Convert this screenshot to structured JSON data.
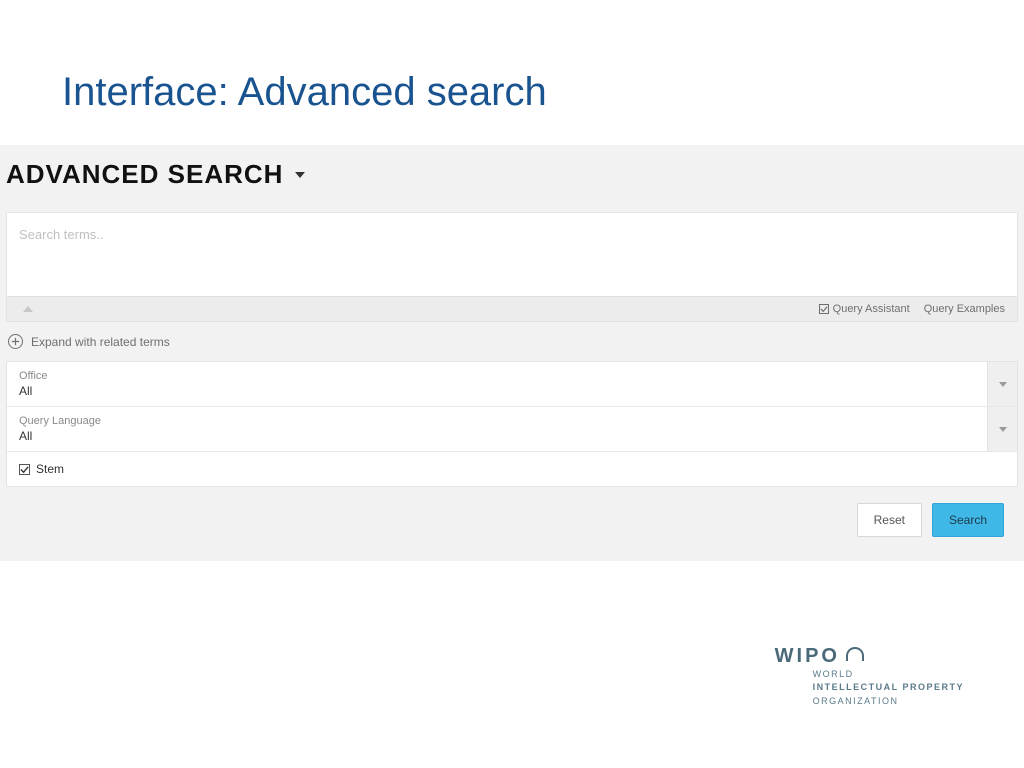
{
  "slide": {
    "title": "Interface: Advanced search"
  },
  "panel": {
    "heading": "ADVANCED SEARCH",
    "search_placeholder": "Search terms..",
    "toolbar": {
      "query_assistant_label": "Query Assistant",
      "query_assistant_checked": true,
      "query_examples_label": "Query Examples"
    },
    "expand_label": "Expand with related terms",
    "filters": {
      "office": {
        "label": "Office",
        "value": "All"
      },
      "query_language": {
        "label": "Query Language",
        "value": "All"
      },
      "stem": {
        "label": "Stem",
        "checked": true
      }
    },
    "buttons": {
      "reset": "Reset",
      "search": "Search"
    }
  },
  "footer": {
    "brand": "WIPO",
    "line1": "WORLD",
    "line2": "INTELLECTUAL PROPERTY",
    "line3": "ORGANIZATION"
  }
}
